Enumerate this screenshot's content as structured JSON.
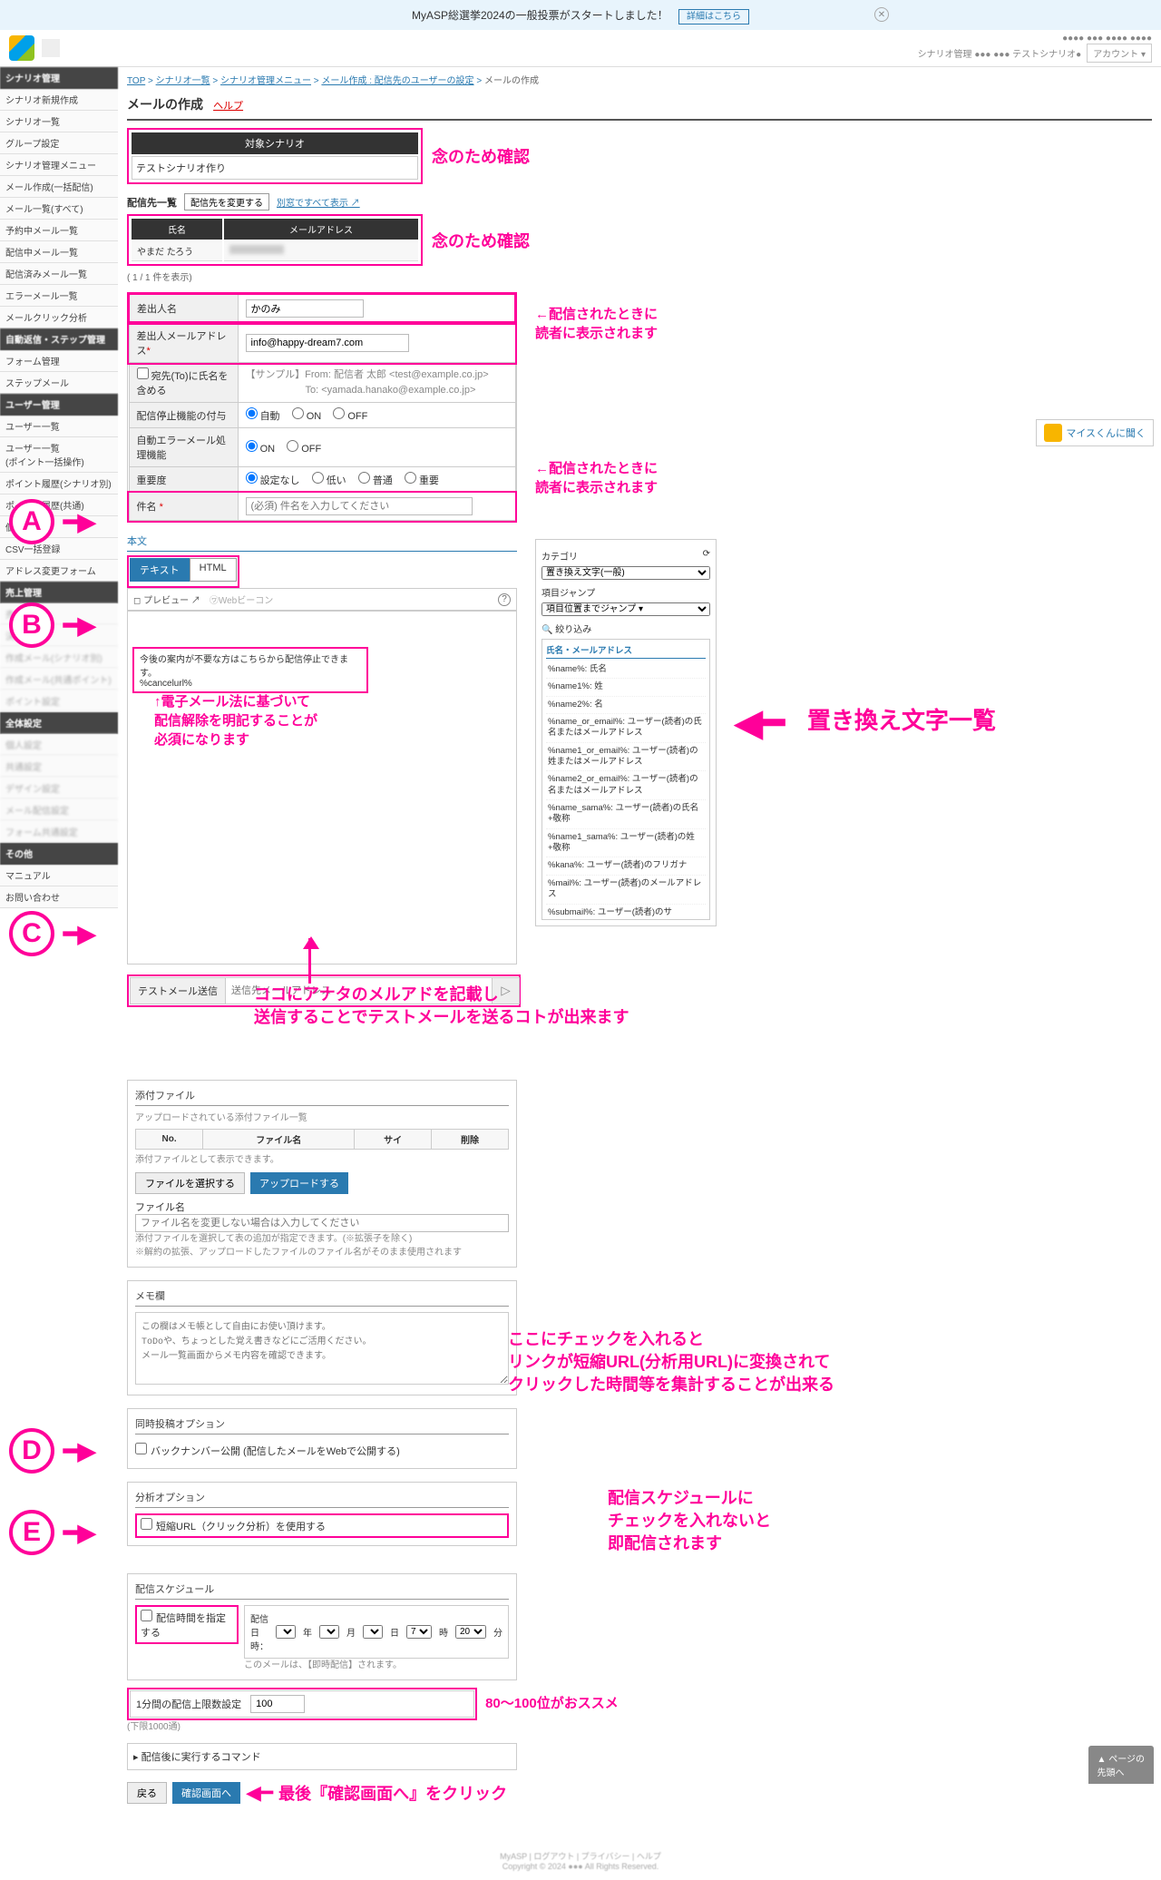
{
  "banner": {
    "text": "MyASP総選挙2024の一般投票がスタートしました！",
    "link": "詳細はこちら"
  },
  "header": {
    "account": "アカウント ▾",
    "subline1": "●●●● ●●● ●●●● ●●●●",
    "subline2": "シナリオ管理 ●●● ●●● テストシナリオ●"
  },
  "sidebar": {
    "g1": "シナリオ管理",
    "items1": [
      "シナリオ新規作成",
      "シナリオ一覧",
      "グループ設定",
      "シナリオ管理メニュー",
      "メール作成(一括配信)",
      "メール一覧(すべて)",
      "予約中メール一覧",
      "配信中メール一覧",
      "配信済みメール一覧",
      "エラーメール一覧",
      "メールクリック分析"
    ],
    "g2": "自動返信・ステップ管理",
    "items2": [
      "フォーム管理",
      "ステップメール"
    ],
    "g3": "ユーザー管理",
    "items3": [
      "ユーザー一覧",
      "ユーザー一覧\n(ポイント一括操作)",
      "ポイント履歴(シナリオ別)",
      "ポイント履歴(共通)",
      "個別登録",
      "CSV一括登録",
      "アドレス変更フォーム"
    ],
    "g4": "売上管理",
    "items4b": [
      "売上一覧",
      "決済履歴",
      "作成メール(シナリオ別)",
      "作成メール(共通ポイント)",
      "ポイント設定"
    ],
    "g5": "全体設定",
    "items5b": [
      "個人設定",
      "共通設定",
      "デザイン設定",
      "メール配信設定",
      "フォーム共通設定"
    ],
    "g6": "その他",
    "items6": [
      "マニュアル",
      "お問い合わせ"
    ]
  },
  "breadcrumb": {
    "i1": "TOP",
    "i2": "シナリオ一覧",
    "i3": "シナリオ管理メニュー",
    "i4": "メール作成 : 配信先のユーザーの設定",
    "cur": "メールの作成"
  },
  "page": {
    "title": "メールの作成",
    "help": "ヘルプ"
  },
  "target": {
    "th": "対象シナリオ",
    "val": "テストシナリオ作り"
  },
  "annot": {
    "confirm": "念のため確認",
    "sender_note": "←配信されたときに\n読者に表示されます",
    "subject_note": "←配信されたときに\n読者に表示されます",
    "unsub_text": "今後の案内が不要な方はこちらから配信停止できます。\n%cancelurl%",
    "unsub_note": "↑電子メール法に基づいて\n配信解除を明記することが\n必須になります",
    "replace_title": "置き換え文字一覧",
    "test_note": "ココにアナタのメルアドを記載し\n送信することでテストメールを送るコトが出来ます",
    "short_url_note": "ここにチェックを入れると\nリンクが短縮URL(分析用URL)に変換されて\nクリックした時間等を集計することが出来る",
    "sched_note": "配信スケジュールに\nチェックを入れないと\n即配信されます",
    "limit_note": "80〜100位がおススメ",
    "final_note": "最後『確認画面へ』をクリック"
  },
  "dest": {
    "label": "配信先一覧",
    "btn": "配信先を変更する",
    "link": "別窓ですべて表示 ↗",
    "th1": "氏名",
    "th2": "メールアドレス",
    "name": "やまだ たろう",
    "count": "( 1 / 1 件を表示)"
  },
  "form": {
    "sender_name_lbl": "差出人名",
    "sender_name": "かのみ",
    "sender_email_lbl": "差出人メールアドレス",
    "sender_email": "info@happy-dream7.com",
    "to_name_lbl": "宛先(To)に氏名を含める",
    "sample_from": "【サンプル】From: 配信者 太郎 <test@example.co.jp>\n　　　　　　To: <yamada.hanako@example.co.jp>",
    "stop_lbl": "配信停止機能の付与",
    "opt_auto": "自動",
    "opt_on": "ON",
    "opt_off": "OFF",
    "err_lbl": "自動エラーメール処理機能",
    "priority_lbl": "重要度",
    "p0": "設定なし",
    "p1": "低い",
    "p2": "普通",
    "p3": "重要",
    "subject_lbl": "件名",
    "subject_ph": "(必須) 件名を入力してください"
  },
  "body": {
    "hd": "本文",
    "tab_text": "テキスト",
    "tab_html": "HTML",
    "preview": "◻ プレビュー ↗",
    "beacon": "㋻Webビーコン"
  },
  "vars": {
    "cat_lbl": "カテゴリ",
    "cat_sel": "置き換え文字(一般)",
    "jump_lbl": "項目ジャンプ",
    "jump_sel": "項目位置までジャンプ ▾",
    "filter": "絞り込み",
    "hd": "氏名・メールアドレス",
    "list": [
      "%name%: 氏名",
      "%name1%: 姓",
      "%name2%: 名",
      "%name_or_email%: ユーザー(読者)の氏名またはメールアドレス",
      "%name1_or_email%: ユーザー(読者)の姓またはメールアドレス",
      "%name2_or_email%: ユーザー(読者)の名またはメールアドレス",
      "%name_sama%: ユーザー(読者)の氏名+敬称",
      "%name1_sama%: ユーザー(読者)の姓+敬称",
      "%kana%: ユーザー(読者)のフリガナ",
      "%mail%: ユーザー(読者)のメールアドレス",
      "%submail%: ユーザー(読者)のサ"
    ]
  },
  "test": {
    "lbl": "テストメール送信",
    "ph": "送信先メールアドレス",
    "btn": "▷"
  },
  "attach": {
    "hd": "添付ファイル",
    "sub": "アップロードされている添付ファイル一覧",
    "th_no": "No.",
    "th_name": "ファイル名",
    "th_size": "サイ",
    "th_del": "削除",
    "note": "添付ファイルとして表示できます。",
    "file_sel": "ファイルを選択する",
    "upload": "アップロードする",
    "fn_lbl": "ファイル名",
    "fn_ph": "ファイル名を変更しない場合は入力してください",
    "small1": "添付ファイルを選択して表の追加が指定できます。(※拡張子を除く)",
    "small2": "※解約の拡張、アップロードしたファイルのファイル名がそのまま使用されます"
  },
  "memo": {
    "hd": "メモ欄",
    "ph": "この欄はメモ帳として自由にお使い頂けます。\nToDoや、ちょっとした覚え書きなどにご活用ください。\nメール一覧画面からメモ内容を確認できます。"
  },
  "simul": {
    "hd": "同時投稿オプション",
    "chk": "バックナンバー公開 (配信したメールをWebで公開する)"
  },
  "analysis": {
    "hd": "分析オプション",
    "chk": "短縮URL（クリック分析）を使用する"
  },
  "sched": {
    "hd": "配信スケジュール",
    "chk": "配信時間を指定する",
    "date_lbl": "配信日時：",
    "y": "年",
    "m": "月",
    "d": "日",
    "h_v": "7",
    "h": "時",
    "min_v": "20",
    "min": "分",
    "note": "このメールは、【即時配信】されます。"
  },
  "limit": {
    "lbl": "1分間の配信上限数設定",
    "val": "100",
    "note": "(下限1000通) "
  },
  "cmd": {
    "lbl": "▸ 配信後に実行するコマンド"
  },
  "final": {
    "back": "戻る",
    "confirm": "確認画面へ"
  },
  "myasukun": "マイスくんに聞く",
  "pagetop": "▲ ページの\n先頭へ",
  "letters": {
    "a": "A",
    "b": "B",
    "c": "C",
    "d": "D",
    "e": "E"
  }
}
